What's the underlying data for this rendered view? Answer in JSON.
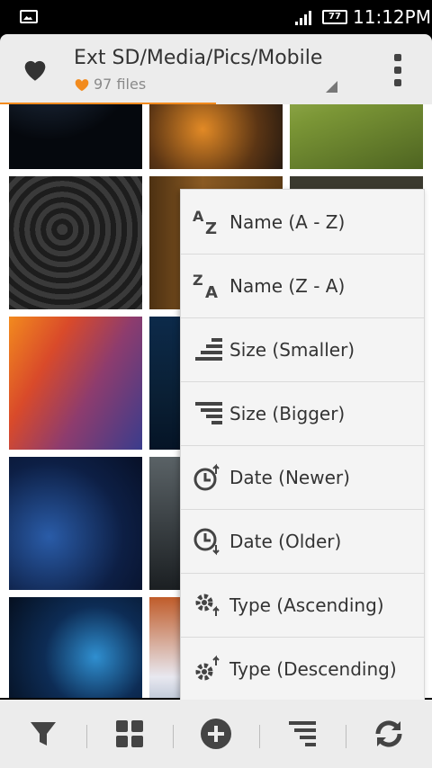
{
  "status_bar": {
    "battery": "77",
    "time": "11:12PM"
  },
  "header": {
    "path": "Ext SD/Media/Pics/Mobile",
    "file_count": "97 files"
  },
  "sort_menu": {
    "items": [
      {
        "label": "Name (A - Z)",
        "icon": "sort-alpha-asc-icon"
      },
      {
        "label": "Name (Z - A)",
        "icon": "sort-alpha-desc-icon"
      },
      {
        "label": "Size (Smaller)",
        "icon": "sort-size-asc-icon"
      },
      {
        "label": "Size (Bigger)",
        "icon": "sort-size-desc-icon"
      },
      {
        "label": "Date (Newer)",
        "icon": "clock-newer-icon"
      },
      {
        "label": "Date (Older)",
        "icon": "clock-older-icon"
      },
      {
        "label": "Type (Ascending)",
        "icon": "gear-asc-icon"
      },
      {
        "label": "Type (Descending)",
        "icon": "gear-desc-icon"
      }
    ]
  },
  "bottom_bar": {
    "buttons": [
      "filter-icon",
      "grid-view-icon",
      "add-icon",
      "sort-icon",
      "refresh-icon"
    ]
  },
  "colors": {
    "accent": "#f28b1e",
    "header_bg": "#ececec",
    "menu_bg": "#f4f4f4"
  }
}
